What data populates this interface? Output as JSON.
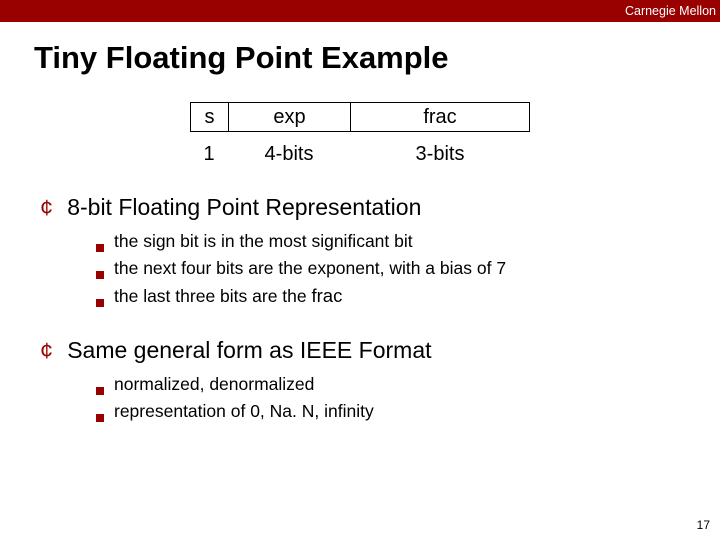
{
  "brand": "Carnegie Mellon",
  "title": "Tiny Floating Point Example",
  "fields": {
    "headers": {
      "s": "s",
      "exp": "exp",
      "frac": "frac"
    },
    "widths": {
      "s": "1",
      "exp": "4-bits",
      "frac": "3-bits"
    }
  },
  "body": [
    {
      "headline": "8-bit Floating Point Representation",
      "items": [
        {
          "text": "the sign bit is in the most significant bit"
        },
        {
          "text": "the next four bits are the exponent, with a bias of 7"
        },
        {
          "text_pre": "the last three bits are the ",
          "frac": "frac"
        }
      ]
    },
    {
      "headline": "Same general form as IEEE Format",
      "items": [
        {
          "text": "normalized, denormalized"
        },
        {
          "text": "representation of 0, Na. N, infinity"
        }
      ]
    }
  ],
  "page_number": "17"
}
